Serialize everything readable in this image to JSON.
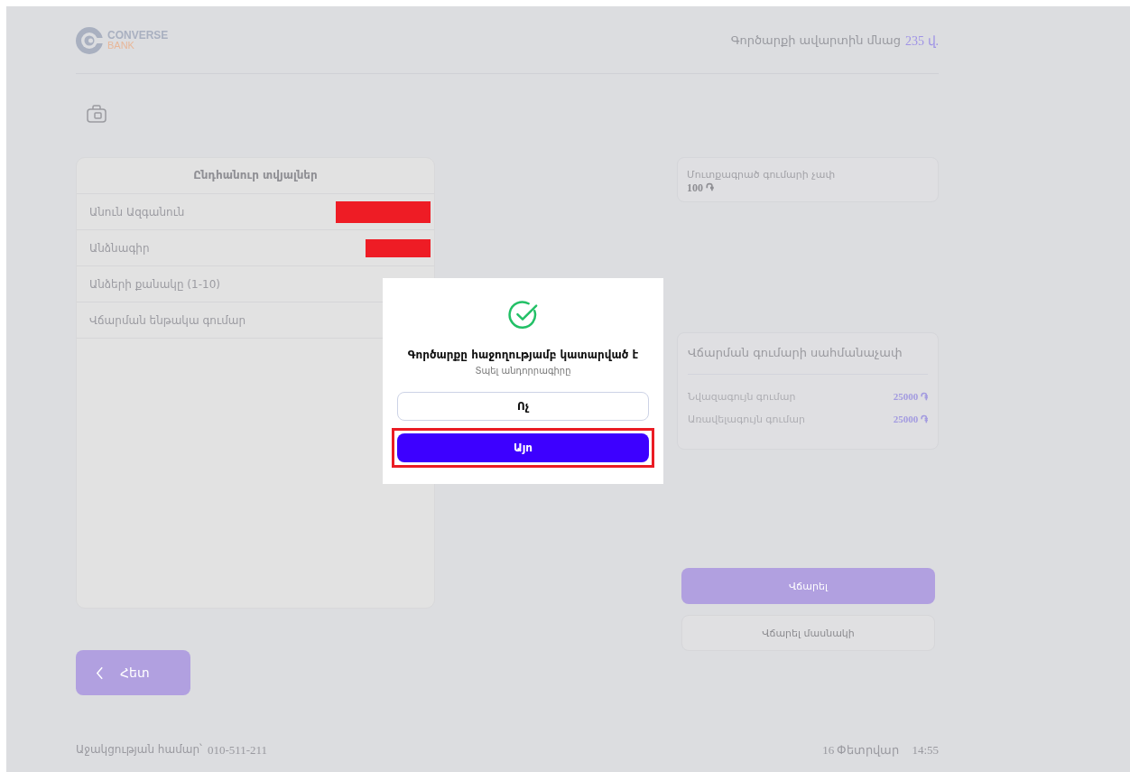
{
  "header": {
    "logo": {
      "name": "CONVERSE",
      "sub": "BANK"
    },
    "timer": {
      "label": "Գործարքի ավարտին մնաց",
      "value": "235 վ."
    }
  },
  "general_info": {
    "title": "Ընդհանուր տվյալներ",
    "rows": [
      {
        "label": "Անուն Ազգանուն",
        "redacted": true
      },
      {
        "label": "Անձնագիր",
        "redacted": true
      },
      {
        "label": "Անձերի քանակը (1-10)",
        "redacted": false
      },
      {
        "label": "Վճարման ենթակա գումար",
        "redacted": false
      }
    ]
  },
  "entered_amount": {
    "label": "Մուտքագրած գումարի չափ",
    "value": "100 ֏"
  },
  "limits": {
    "title": "Վճարման գումարի սահմանաչափ",
    "rows": [
      {
        "label": "Նվազագույն գումար",
        "value": "25000 ֏"
      },
      {
        "label": "Առավելագույն գումար",
        "value": "25000 ֏"
      }
    ]
  },
  "actions": [
    {
      "label": "Վճարել",
      "kind": "primary"
    },
    {
      "label": "Վճարել մասնակի",
      "kind": "secondary"
    }
  ],
  "back_button": "Հետ",
  "footer": {
    "support_label": "Աջակցության համար՝",
    "support_phone": "010-511-211",
    "date": "16 Փետրվար",
    "time": "14:55"
  },
  "dialog": {
    "title": "Գործարքը հաջողությամբ կատարված է",
    "subtitle": "Տպել անդորրագիրը",
    "buttons": [
      {
        "label": "Ոչ",
        "kind": "secondary",
        "highlighted": false
      },
      {
        "label": "Այո",
        "kind": "primary",
        "highlighted": true
      }
    ]
  }
}
